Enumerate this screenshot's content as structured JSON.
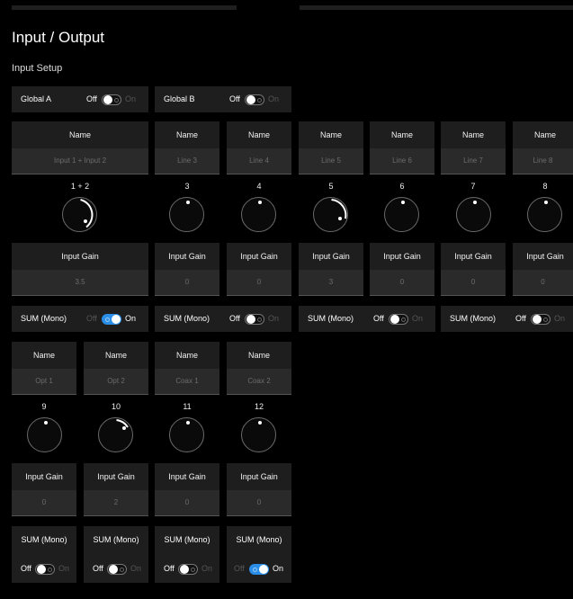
{
  "page": {
    "title": "Input / Output",
    "subtitle": "Input Setup"
  },
  "global": [
    {
      "label": "Global A",
      "off": "Off",
      "on": "On",
      "state": "off"
    },
    {
      "label": "Global B",
      "off": "Off",
      "on": "On",
      "state": "off"
    }
  ],
  "row1": {
    "name_label": "Name",
    "gain_label": "Input Gain",
    "channels": [
      {
        "num": "1 + 2",
        "name": "Input 1 + Input 2",
        "gain": "3.5"
      },
      {
        "num": "3",
        "name": "Line 3",
        "gain": "0"
      },
      {
        "num": "4",
        "name": "Line 4",
        "gain": "0"
      },
      {
        "num": "5",
        "name": "Line 5",
        "gain": "3"
      },
      {
        "num": "6",
        "name": "Line 6",
        "gain": "0"
      },
      {
        "num": "7",
        "name": "Line 7",
        "gain": "0"
      },
      {
        "num": "8",
        "name": "Line 8",
        "gain": "0"
      }
    ],
    "sum": [
      {
        "label": "SUM (Mono)",
        "off": "Off",
        "on": "On",
        "state": "on"
      },
      {
        "label": "SUM (Mono)",
        "off": "Off",
        "on": "On",
        "state": "off"
      },
      {
        "label": "SUM (Mono)",
        "off": "Off",
        "on": "On",
        "state": "off"
      },
      {
        "label": "SUM (Mono)",
        "off": "Off",
        "on": "On",
        "state": "off"
      }
    ]
  },
  "row2": {
    "name_label": "Name",
    "gain_label": "Input Gain",
    "channels": [
      {
        "num": "9",
        "name": "Opt 1",
        "gain": "0",
        "sum_label": "SUM (Mono)",
        "off": "Off",
        "on": "On",
        "state": "off"
      },
      {
        "num": "10",
        "name": "Opt 2",
        "gain": "2",
        "sum_label": "SUM (Mono)",
        "off": "Off",
        "on": "On",
        "state": "off"
      },
      {
        "num": "11",
        "name": "Coax 1",
        "gain": "0",
        "sum_label": "SUM (Mono)",
        "off": "Off",
        "on": "On",
        "state": "off"
      },
      {
        "num": "12",
        "name": "Coax 2",
        "gain": "0",
        "sum_label": "SUM (Mono)",
        "off": "Off",
        "on": "On",
        "state": "on"
      }
    ]
  },
  "colors": {
    "accent": "#2a8ee8",
    "panel": "#1e1e1e",
    "field": "#2a2a2a"
  }
}
